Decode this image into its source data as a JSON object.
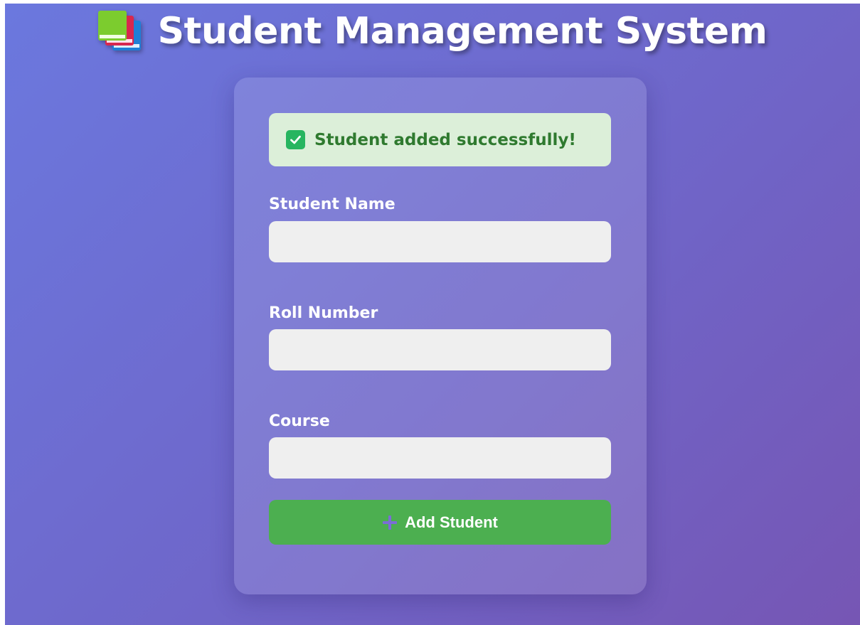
{
  "header": {
    "icon": "books-icon",
    "title": "Student Management System"
  },
  "alert": {
    "icon": "check-icon",
    "message": "Student added successfully!",
    "colors": {
      "background": "#dcefd9",
      "text": "#2f7a2f",
      "icon": "#27b560"
    }
  },
  "form": {
    "fields": [
      {
        "label": "Student Name",
        "value": "",
        "placeholder": ""
      },
      {
        "label": "Roll Number",
        "value": "",
        "placeholder": ""
      },
      {
        "label": "Course",
        "value": "",
        "placeholder": ""
      }
    ],
    "submit": {
      "icon": "plus-icon",
      "label": "Add Student",
      "color": "#4caf50"
    }
  }
}
